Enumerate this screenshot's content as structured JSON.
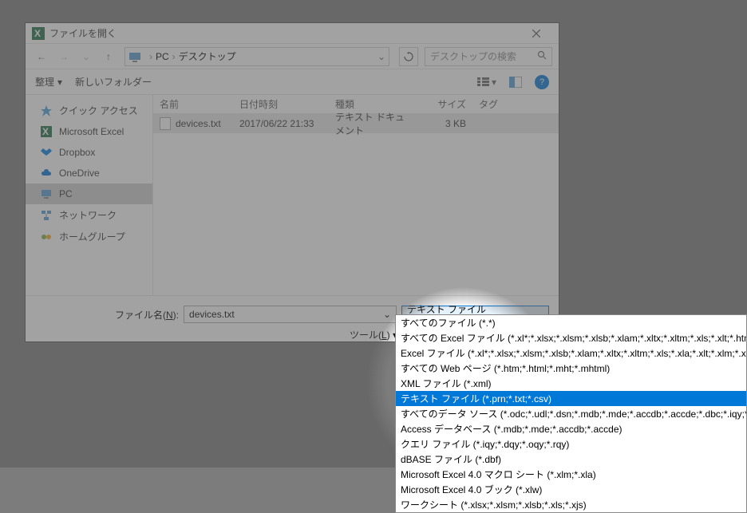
{
  "window": {
    "title": "ファイルを開く"
  },
  "nav": {
    "pc": "PC",
    "location": "デスクトップ",
    "search_placeholder": "デスクトップの検索"
  },
  "toolbar": {
    "organize": "整理",
    "new_folder": "新しいフォルダー"
  },
  "sidebar": {
    "items": [
      {
        "label": "クイック アクセス",
        "icon": "star",
        "color": "#4aa3df"
      },
      {
        "label": "Microsoft Excel",
        "icon": "excel",
        "color": "#1e7145"
      },
      {
        "label": "Dropbox",
        "icon": "dropbox",
        "color": "#007ee5"
      },
      {
        "label": "OneDrive",
        "icon": "cloud",
        "color": "#0078d7"
      },
      {
        "label": "PC",
        "icon": "pc",
        "color": "#5a9bd4",
        "selected": true
      },
      {
        "label": "ネットワーク",
        "icon": "network",
        "color": "#5a9bd4"
      },
      {
        "label": "ホームグループ",
        "icon": "home",
        "color": "#7cb342"
      }
    ]
  },
  "columns": {
    "name": "名前",
    "date": "日付時刻",
    "type": "種類",
    "size": "サイズ",
    "tag": "タグ"
  },
  "files": [
    {
      "name": "devices.txt",
      "date": "2017/06/22 21:33",
      "type": "テキスト ドキュメント",
      "size": "3 KB"
    }
  ],
  "bottom": {
    "filename_label_pre": "ファイル名(",
    "filename_label_u": "N",
    "filename_label_post": "):",
    "filename_value": "devices.txt",
    "filetype_value": "テキスト ファイル (*.prn;*.txt;*.csv)",
    "tool_pre": "ツール(",
    "tool_u": "L",
    "tool_post": ")"
  },
  "dropdown": {
    "items": [
      "すべてのファイル (*.*)",
      "すべての Excel ファイル (*.xl*;*.xlsx;*.xlsm;*.xlsb;*.xlam;*.xltx;*.xltm;*.xls;*.xlt;*.htm;*.ht",
      "Excel ファイル (*.xl*;*.xlsx;*.xlsm;*.xlsb;*.xlam;*.xltx;*.xltm;*.xls;*.xla;*.xlt;*.xlm;*.xlw;*.",
      "すべての Web ページ (*.htm;*.html;*.mht;*.mhtml)",
      "XML ファイル (*.xml)",
      "テキスト ファイル (*.prn;*.txt;*.csv)",
      "すべてのデータ ソース (*.odc;*.udl;*.dsn;*.mdb;*.mde;*.accdb;*.accde;*.dbc;*.iqy;*.dqy;*",
      "Access データベース (*.mdb;*.mde;*.accdb;*.accde)",
      "クエリ ファイル (*.iqy;*.dqy;*.oqy;*.rqy)",
      "dBASE ファイル (*.dbf)",
      "Microsoft Excel 4.0 マクロ シート (*.xlm;*.xla)",
      "Microsoft Excel 4.0 ブック (*.xlw)",
      "ワークシート (*.xlsx;*.xlsm;*.xlsb;*.xls;*.xjs)"
    ],
    "selected_index": 5
  }
}
